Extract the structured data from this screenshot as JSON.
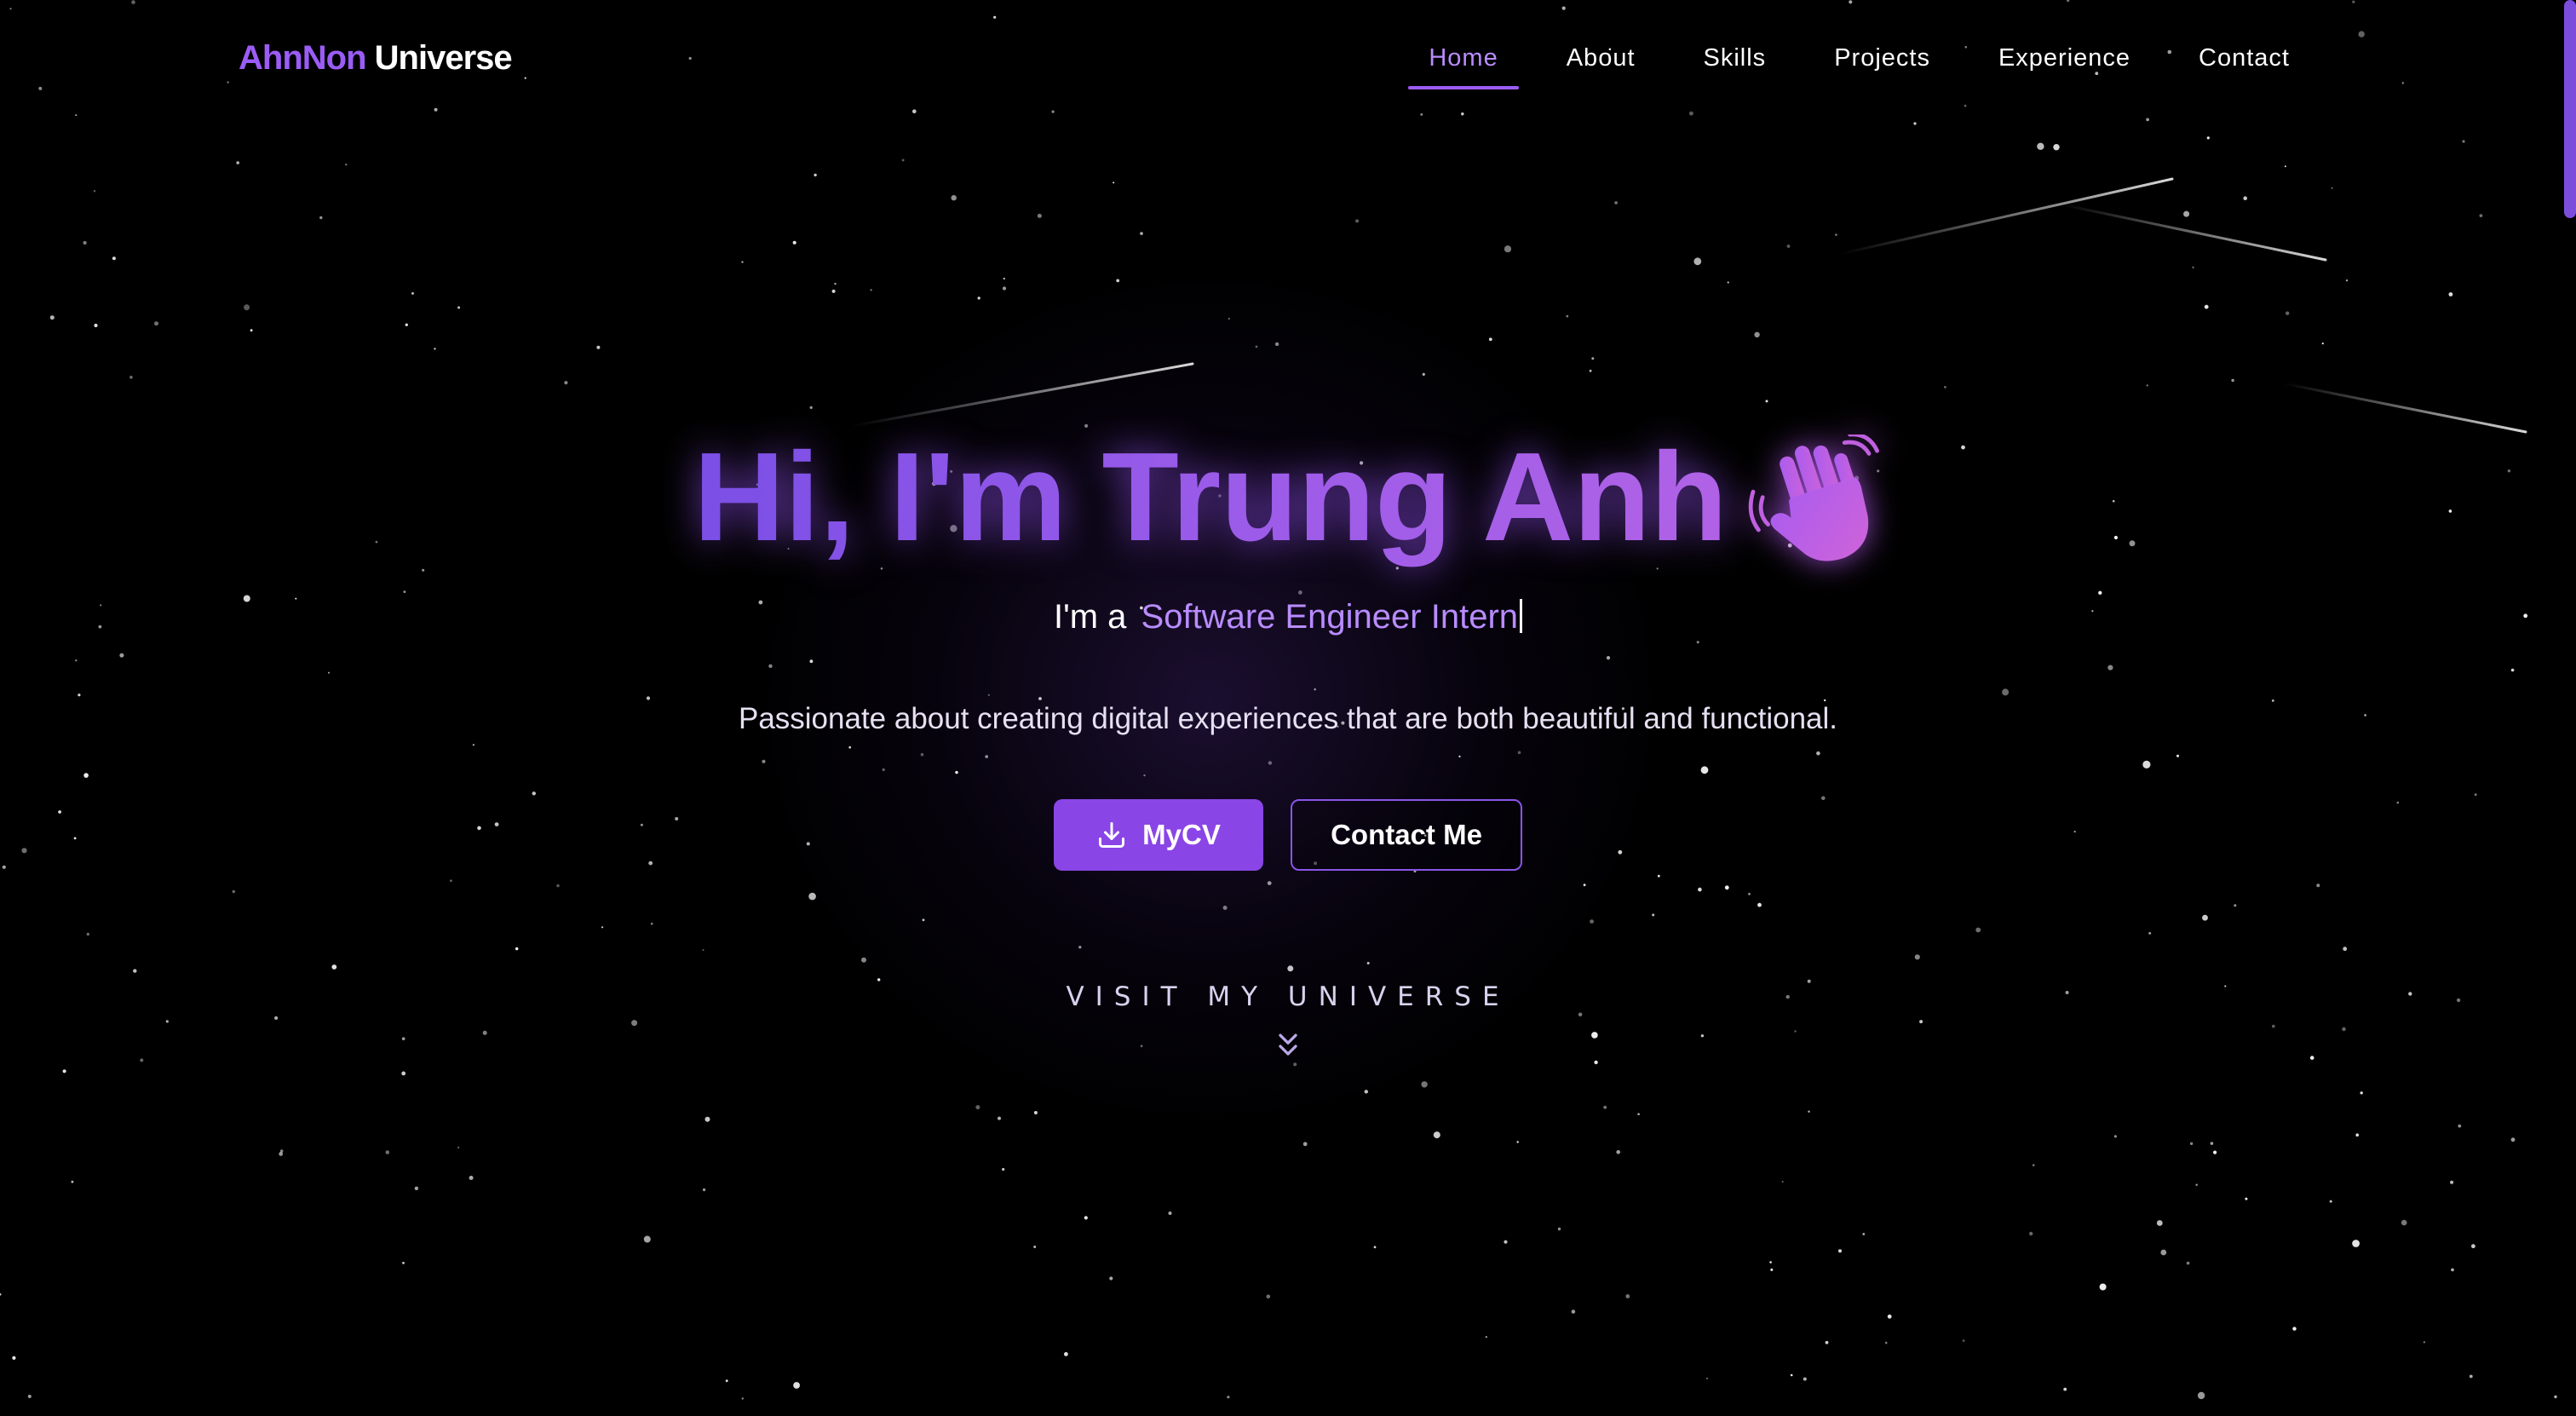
{
  "brand": {
    "part1": "AhnNon",
    "part2": "Universe"
  },
  "nav": {
    "items": [
      {
        "label": "Home",
        "active": true
      },
      {
        "label": "About",
        "active": false
      },
      {
        "label": "Skills",
        "active": false
      },
      {
        "label": "Projects",
        "active": false
      },
      {
        "label": "Experience",
        "active": false
      },
      {
        "label": "Contact",
        "active": false
      }
    ]
  },
  "hero": {
    "title": "Hi, I'm Trung Anh",
    "title_icon": "waving-hand-icon",
    "subtitle_prefix": "I'm a",
    "subtitle_role": "Software Engineer Intern",
    "tagline": "Passionate about creating digital experiences that are both beautiful and functional.",
    "primary_button": {
      "label": "MyCV",
      "icon": "download-icon"
    },
    "secondary_button": {
      "label": "Contact Me"
    },
    "scroll_prompt": "VISIT MY UNIVERSE",
    "scroll_icon": "double-chevron-down-icon"
  },
  "colors": {
    "background": "#000000",
    "accent": "#9b5cf6",
    "accent_light": "#b98cff",
    "button_primary": "#8a45e6"
  }
}
